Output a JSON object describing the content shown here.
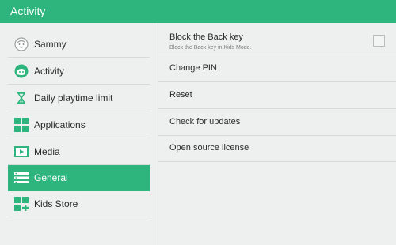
{
  "header": {
    "title": "Activity"
  },
  "colors": {
    "accent": "#2db57d",
    "background": "#eef0ef"
  },
  "sidebar": {
    "items": [
      {
        "label": "Sammy",
        "icon": "face-icon",
        "active": false
      },
      {
        "label": "Activity",
        "icon": "activity-icon",
        "active": false
      },
      {
        "label": "Daily playtime limit",
        "icon": "hourglass-icon",
        "active": false
      },
      {
        "label": "Applications",
        "icon": "apps-grid-icon",
        "active": false
      },
      {
        "label": "Media",
        "icon": "media-icon",
        "active": false
      },
      {
        "label": "General",
        "icon": "list-icon",
        "active": true
      },
      {
        "label": "Kids Store",
        "icon": "store-icon",
        "active": false
      }
    ]
  },
  "settings": {
    "block_back": {
      "label": "Block the Back key",
      "description": "Block the Back key in Kids Mode.",
      "checked": false
    },
    "change_pin": {
      "label": "Change PIN"
    },
    "reset": {
      "label": "Reset"
    },
    "check_updates": {
      "label": "Check for updates"
    },
    "open_source": {
      "label": "Open source license"
    }
  }
}
